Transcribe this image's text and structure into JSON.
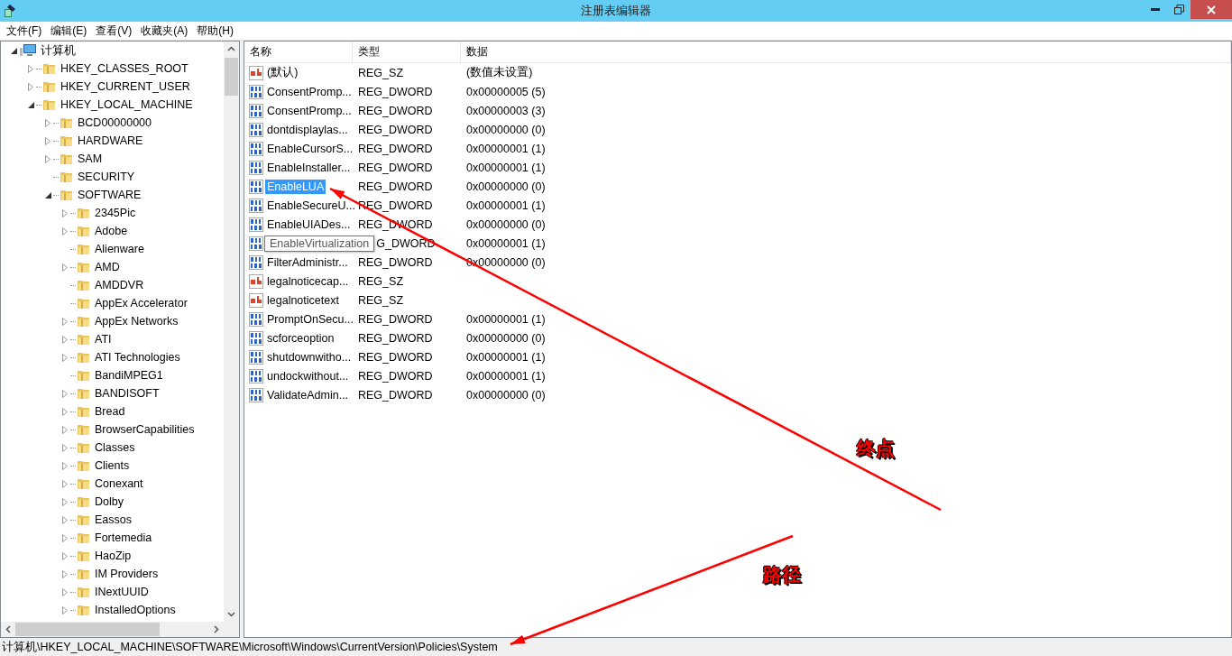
{
  "window": {
    "title": "注册表编辑器"
  },
  "menu": [
    "文件(F)",
    "编辑(E)",
    "查看(V)",
    "收藏夹(A)",
    "帮助(H)"
  ],
  "tree": {
    "label": "计算机",
    "kind": "computer",
    "expanded": true,
    "children": [
      {
        "label": "HKEY_CLASSES_ROOT",
        "expanded": false
      },
      {
        "label": "HKEY_CURRENT_USER",
        "expanded": false
      },
      {
        "label": "HKEY_LOCAL_MACHINE",
        "expanded": true,
        "children": [
          {
            "label": "BCD00000000",
            "expanded": false
          },
          {
            "label": "HARDWARE",
            "expanded": false
          },
          {
            "label": "SAM",
            "expanded": false
          },
          {
            "label": "SECURITY"
          },
          {
            "label": "SOFTWARE",
            "expanded": true,
            "children": [
              {
                "label": "2345Pic",
                "expanded": false
              },
              {
                "label": "Adobe",
                "expanded": false
              },
              {
                "label": "Alienware"
              },
              {
                "label": "AMD",
                "expanded": false
              },
              {
                "label": "AMDDVR"
              },
              {
                "label": "AppEx Accelerator"
              },
              {
                "label": "AppEx Networks",
                "expanded": false
              },
              {
                "label": "ATI",
                "expanded": false
              },
              {
                "label": "ATI Technologies",
                "expanded": false
              },
              {
                "label": "BandiMPEG1"
              },
              {
                "label": "BANDISOFT",
                "expanded": false
              },
              {
                "label": "Bread",
                "expanded": false
              },
              {
                "label": "BrowserCapabilities",
                "expanded": false
              },
              {
                "label": "Classes",
                "expanded": false
              },
              {
                "label": "Clients",
                "expanded": false
              },
              {
                "label": "Conexant",
                "expanded": false
              },
              {
                "label": "Dolby",
                "expanded": false
              },
              {
                "label": "Eassos",
                "expanded": false
              },
              {
                "label": "Fortemedia",
                "expanded": false
              },
              {
                "label": "HaoZip",
                "expanded": false
              },
              {
                "label": "IM Providers",
                "expanded": false
              },
              {
                "label": "INextUUID",
                "expanded": false
              },
              {
                "label": "InstalledOptions",
                "expanded": false
              }
            ]
          }
        ]
      }
    ]
  },
  "table": {
    "columns": [
      "名称",
      "类型",
      "数据"
    ],
    "rows": [
      {
        "name": "(默认)",
        "kind": "string",
        "type": "REG_SZ",
        "data": "(数值未设置)",
        "selected": false
      },
      {
        "name": "ConsentPromp...",
        "kind": "dword",
        "type": "REG_DWORD",
        "data": "0x00000005 (5)",
        "selected": false
      },
      {
        "name": "ConsentPromp...",
        "kind": "dword",
        "type": "REG_DWORD",
        "data": "0x00000003 (3)",
        "selected": false
      },
      {
        "name": "dontdisplaylas...",
        "kind": "dword",
        "type": "REG_DWORD",
        "data": "0x00000000 (0)",
        "selected": false
      },
      {
        "name": "EnableCursorS...",
        "kind": "dword",
        "type": "REG_DWORD",
        "data": "0x00000001 (1)",
        "selected": false
      },
      {
        "name": "EnableInstaller...",
        "kind": "dword",
        "type": "REG_DWORD",
        "data": "0x00000001 (1)",
        "selected": false
      },
      {
        "name": "EnableLUA",
        "kind": "dword",
        "type": "REG_DWORD",
        "data": "0x00000000 (0)",
        "selected": true
      },
      {
        "name": "EnableSecureU...",
        "kind": "dword",
        "type": "REG_DWORD",
        "data": "0x00000001 (1)",
        "selected": false
      },
      {
        "name": "EnableUIADes...",
        "kind": "dword",
        "type": "REG_DWORD",
        "data": "0x00000000 (0)",
        "selected": false
      },
      {
        "kind": "dword",
        "type": "G_DWORD",
        "data": "0x00000001 (1)",
        "selected": false,
        "tooltip": "EnableVirtualization"
      },
      {
        "name": "FilterAdministr...",
        "kind": "dword",
        "type": "REG_DWORD",
        "data": "0x00000000 (0)",
        "selected": false
      },
      {
        "name": "legalnoticecap...",
        "kind": "string",
        "type": "REG_SZ",
        "selected": false
      },
      {
        "name": "legalnoticetext",
        "kind": "string",
        "type": "REG_SZ",
        "selected": false
      },
      {
        "name": "PromptOnSecu...",
        "kind": "dword",
        "type": "REG_DWORD",
        "data": "0x00000001 (1)",
        "selected": false
      },
      {
        "name": "scforceoption",
        "kind": "dword",
        "type": "REG_DWORD",
        "data": "0x00000000 (0)",
        "selected": false
      },
      {
        "name": "shutdownwitho...",
        "kind": "dword",
        "type": "REG_DWORD",
        "data": "0x00000001 (1)",
        "selected": false
      },
      {
        "name": "undockwithout...",
        "kind": "dword",
        "type": "REG_DWORD",
        "data": "0x00000001 (1)",
        "selected": false
      },
      {
        "name": "ValidateAdmin...",
        "kind": "dword",
        "type": "REG_DWORD",
        "data": "0x00000000 (0)",
        "selected": false
      }
    ]
  },
  "annotations": [
    {
      "label": "终点"
    },
    {
      "label": "路径"
    }
  ],
  "status_bar": "计算机\\HKEY_LOCAL_MACHINE\\SOFTWARE\\Microsoft\\Windows\\CurrentVersion\\Policies\\System"
}
